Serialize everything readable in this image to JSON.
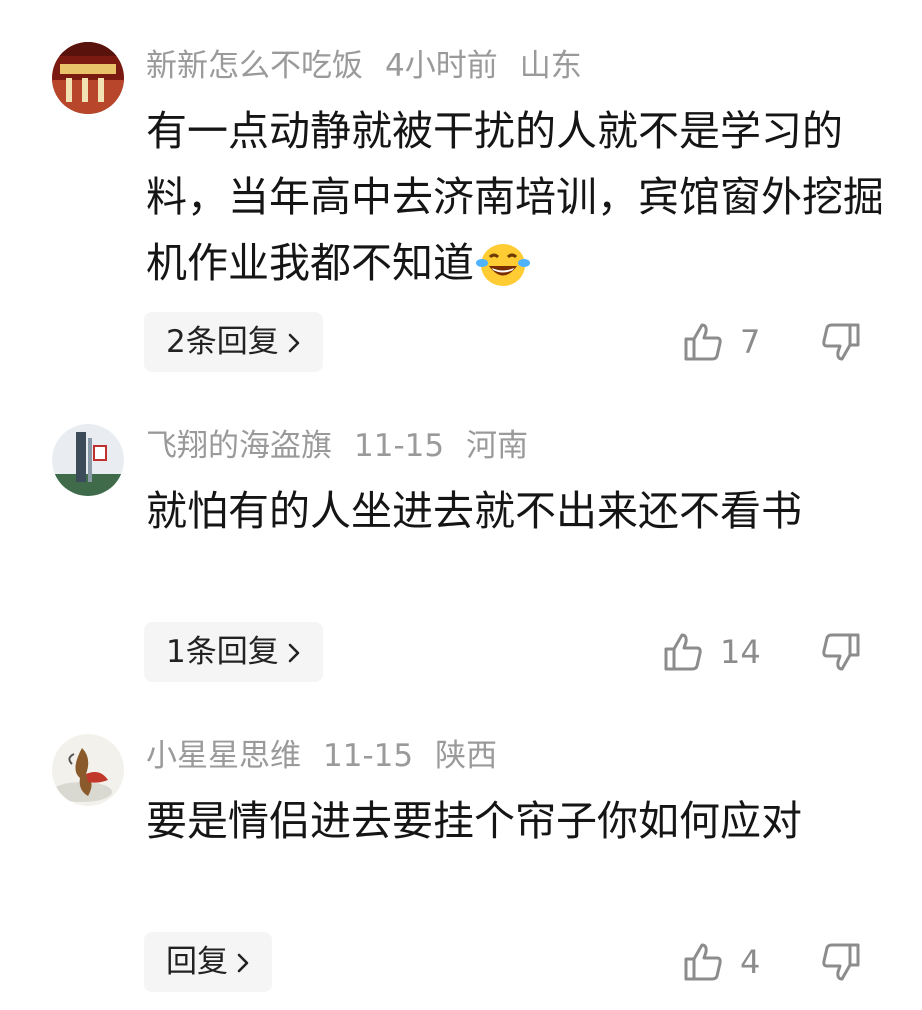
{
  "comments": [
    {
      "username": "新新怎么不吃饭",
      "time": "4小时前",
      "location": "山东",
      "text": "有一点动静就被干扰的人就不是学习的料，当年高中去济南培训，宾馆窗外挖掘机作业我都不知道",
      "emoji": "laughing-crying-emoji",
      "reply_label": "2条回复",
      "likes": "7"
    },
    {
      "username": "飞翔的海盗旗",
      "time": "11-15",
      "location": "河南",
      "text": "就怕有的人坐进去就不出来还不看书",
      "reply_label": "1条回复",
      "likes": "14"
    },
    {
      "username": "小星星思维",
      "time": "11-15",
      "location": "陕西",
      "text": "要是情侣进去要挂个帘子你如何应对",
      "reply_label": "回复",
      "likes": "4"
    }
  ],
  "icons": {
    "like": "thumbs-up-icon",
    "dislike": "thumbs-down-icon",
    "reply_chevron": "chevron-right-icon"
  }
}
